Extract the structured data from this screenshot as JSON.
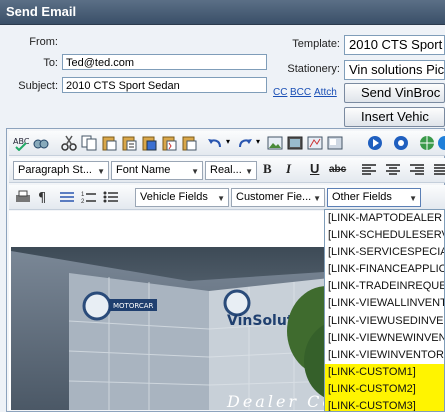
{
  "window": {
    "title": "Send Email"
  },
  "form": {
    "from_label": "From:",
    "to_label": "To:",
    "to_value": "Ted@ted.com",
    "subject_label": "Subject:",
    "subject_value": "2010 CTS Sport Sedan",
    "template_label": "Template:",
    "template_value": "2010 CTS Sport",
    "stationery_label": "Stationery:",
    "stationery_value": "Vin solutions Pic",
    "links": [
      "CC",
      "BCC",
      "Attch"
    ],
    "send_button": "Send VinBroc",
    "insert_button": "Insert Vehic"
  },
  "toolbar": {
    "paragraph_style": "Paragraph St...",
    "font_name": "Font Name",
    "font_size": "Real...",
    "bold": "B",
    "italic": "I",
    "underline": "U",
    "strike": "abc",
    "vehicle_fields": "Vehicle Fields",
    "customer_fields": "Customer Fie...",
    "other_fields": "Other Fields"
  },
  "banner": {
    "sign_text": "VinSolutions.com",
    "sign_small": "MOTORCAR",
    "caption": "Dealer Ce..."
  },
  "dropdown": {
    "items": [
      {
        "label": "[LINK-MAPTODEALER",
        "highlighted": false
      },
      {
        "label": "[LINK-SCHEDULESERV",
        "highlighted": false
      },
      {
        "label": "[LINK-SERVICESPECIAL",
        "highlighted": false
      },
      {
        "label": "[LINK-FINANCEAPPLIC",
        "highlighted": false
      },
      {
        "label": "[LINK-TRADEINREQUE",
        "highlighted": false
      },
      {
        "label": "[LINK-VIEWALLINVENT",
        "highlighted": false
      },
      {
        "label": "[LINK-VIEWUSEDINVEN",
        "highlighted": false
      },
      {
        "label": "[LINK-VIEWNEWINVEN",
        "highlighted": false
      },
      {
        "label": "[LINK-VIEWINVENTOR",
        "highlighted": false
      },
      {
        "label": "[LINK-CUSTOM1]",
        "highlighted": true
      },
      {
        "label": "[LINK-CUSTOM2]",
        "highlighted": true
      },
      {
        "label": "[LINK-CUSTOM3]",
        "highlighted": true
      }
    ]
  },
  "colors": {
    "titlebar": "#3a4f68",
    "highlight": "#fff400",
    "link": "#1a4fb5"
  }
}
